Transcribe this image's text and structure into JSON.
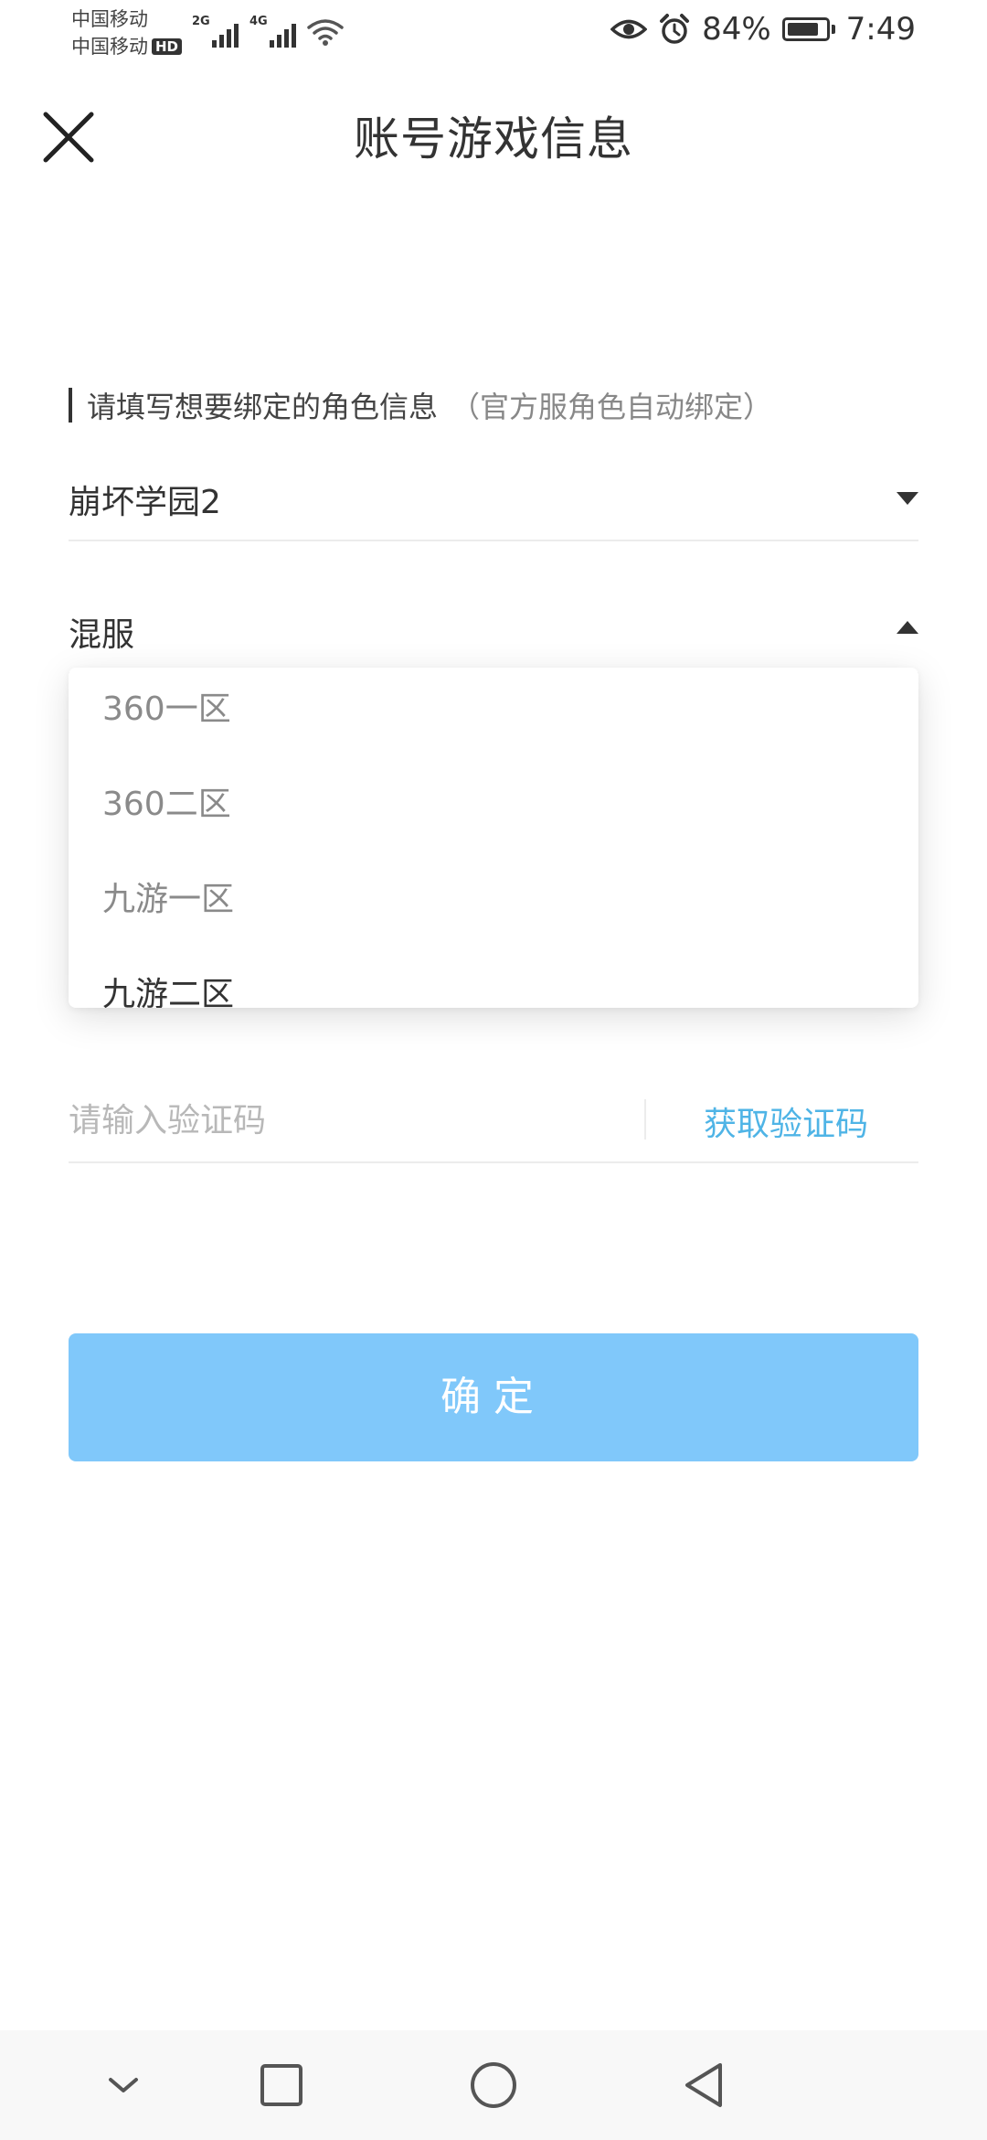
{
  "status_bar": {
    "carrier_1": "中国移动",
    "carrier_2": "中国移动",
    "hd": "HD",
    "signal_1_type": "2G",
    "signal_2_type": "4G",
    "battery_percent": "84%",
    "battery_level": 0.84,
    "time": "7:49"
  },
  "header": {
    "title": "账号游戏信息",
    "close_icon": "close-icon"
  },
  "form": {
    "section_label": "请填写想要绑定的角色信息",
    "section_note": "（官方服角色自动绑定）",
    "game_select": {
      "value": "崩坏学园2",
      "icon": "caret-down-icon"
    },
    "server_select": {
      "value": "混服",
      "icon": "caret-up-icon",
      "expanded": true
    },
    "server_options": [
      "360一区",
      "360二区",
      "九游一区",
      "九游二区"
    ],
    "code_input": {
      "value": "",
      "placeholder": "请输入验证码"
    },
    "get_code_label": "获取验证码",
    "confirm_label": "确定"
  },
  "colors": {
    "accent": "#4fb4e6",
    "button": "#80c8fa",
    "text": "#333333",
    "muted": "#8a8a8a"
  },
  "nav_bar": {
    "icons": [
      "chevron-down-icon",
      "square-recent-icon",
      "circle-home-icon",
      "triangle-back-icon"
    ]
  }
}
